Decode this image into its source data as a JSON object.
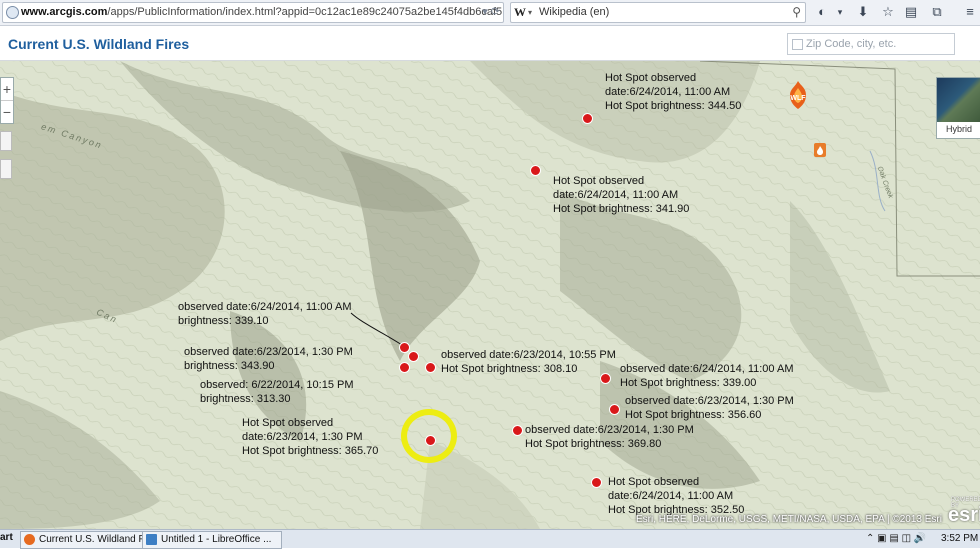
{
  "browser": {
    "url_host": "www.arcgis.com",
    "url_path": "/apps/PublicInformation/index.html?appid=0c12ac1e89c24075a2be145f4db6caf5",
    "search_engine": "Wikipedia (en)",
    "icons": [
      "globe-icon",
      "dropdown-icon",
      "reload-icon",
      "wikipedia-icon",
      "search-icon",
      "addon-icon",
      "download-icon",
      "bookmark-star-icon",
      "clipboard-icon",
      "screenshot-icon",
      "menu-icon"
    ]
  },
  "app": {
    "title": "Current U.S. Wildland Fires",
    "zip_placeholder": "Zip Code, city, etc."
  },
  "map": {
    "basemap_label": "Hybrid",
    "attribution": "Esri, HERE, DeLorme, USGS, METI/NASA, USDA, EPA | ©2013 Esri",
    "esri_logo": "esri",
    "powered_by": "POWERED BY",
    "terrain_labels": [
      "em Canyon",
      "Can",
      "Oak Creek"
    ],
    "popups": [
      {
        "l1": "Hot Spot observed",
        "l2": "date:6/24/2014, 11:00 AM",
        "l3": "Hot Spot brightness: 344.50"
      },
      {
        "l1": "Hot Spot observed",
        "l2": "date:6/24/2014, 11:00 AM",
        "l3": "Hot Spot brightness: 341.90"
      },
      {
        "l1": "observed date:6/24/2014, 11:00 AM",
        "l2": "brightness: 339.10"
      },
      {
        "l1": "observed date:6/23/2014, 1:30 PM",
        "l2": "brightness: 343.90"
      },
      {
        "l1": "observed date:6/23/2014, 10:55 PM",
        "l2": "Hot Spot brightness: 308.10"
      },
      {
        "l1": "observed: 6/22/2014, 10:15 PM",
        "l2": "brightness: 313.30"
      },
      {
        "l1": "observed date:6/24/2014, 11:00 AM",
        "l2": "Hot Spot brightness: 339.00"
      },
      {
        "l1": "observed date:6/23/2014, 1:30 PM",
        "l2": "Hot Spot brightness: 356.60"
      },
      {
        "l1": "Hot Spot observed",
        "l2": "date:6/23/2014, 1:30 PM",
        "l3": "Hot Spot brightness: 365.70"
      },
      {
        "l1": "observed date:6/23/2014, 1:30 PM",
        "l2": "Hot Spot brightness: 369.80"
      },
      {
        "l1": "Hot Spot observed",
        "l2": "date:6/24/2014, 11:00 AM",
        "l3": "Hot Spot brightness: 352.50"
      }
    ],
    "fire_icon_label": "WLF",
    "colors": {
      "hotspot": "#d9181a",
      "highlight": "#eded12",
      "title": "#1f5f9e"
    }
  },
  "taskbar": {
    "start": "art",
    "items": [
      "Current U.S. Wildland F...",
      "Untitled 1 - LibreOffice ..."
    ],
    "clock": "3:52 PM"
  }
}
